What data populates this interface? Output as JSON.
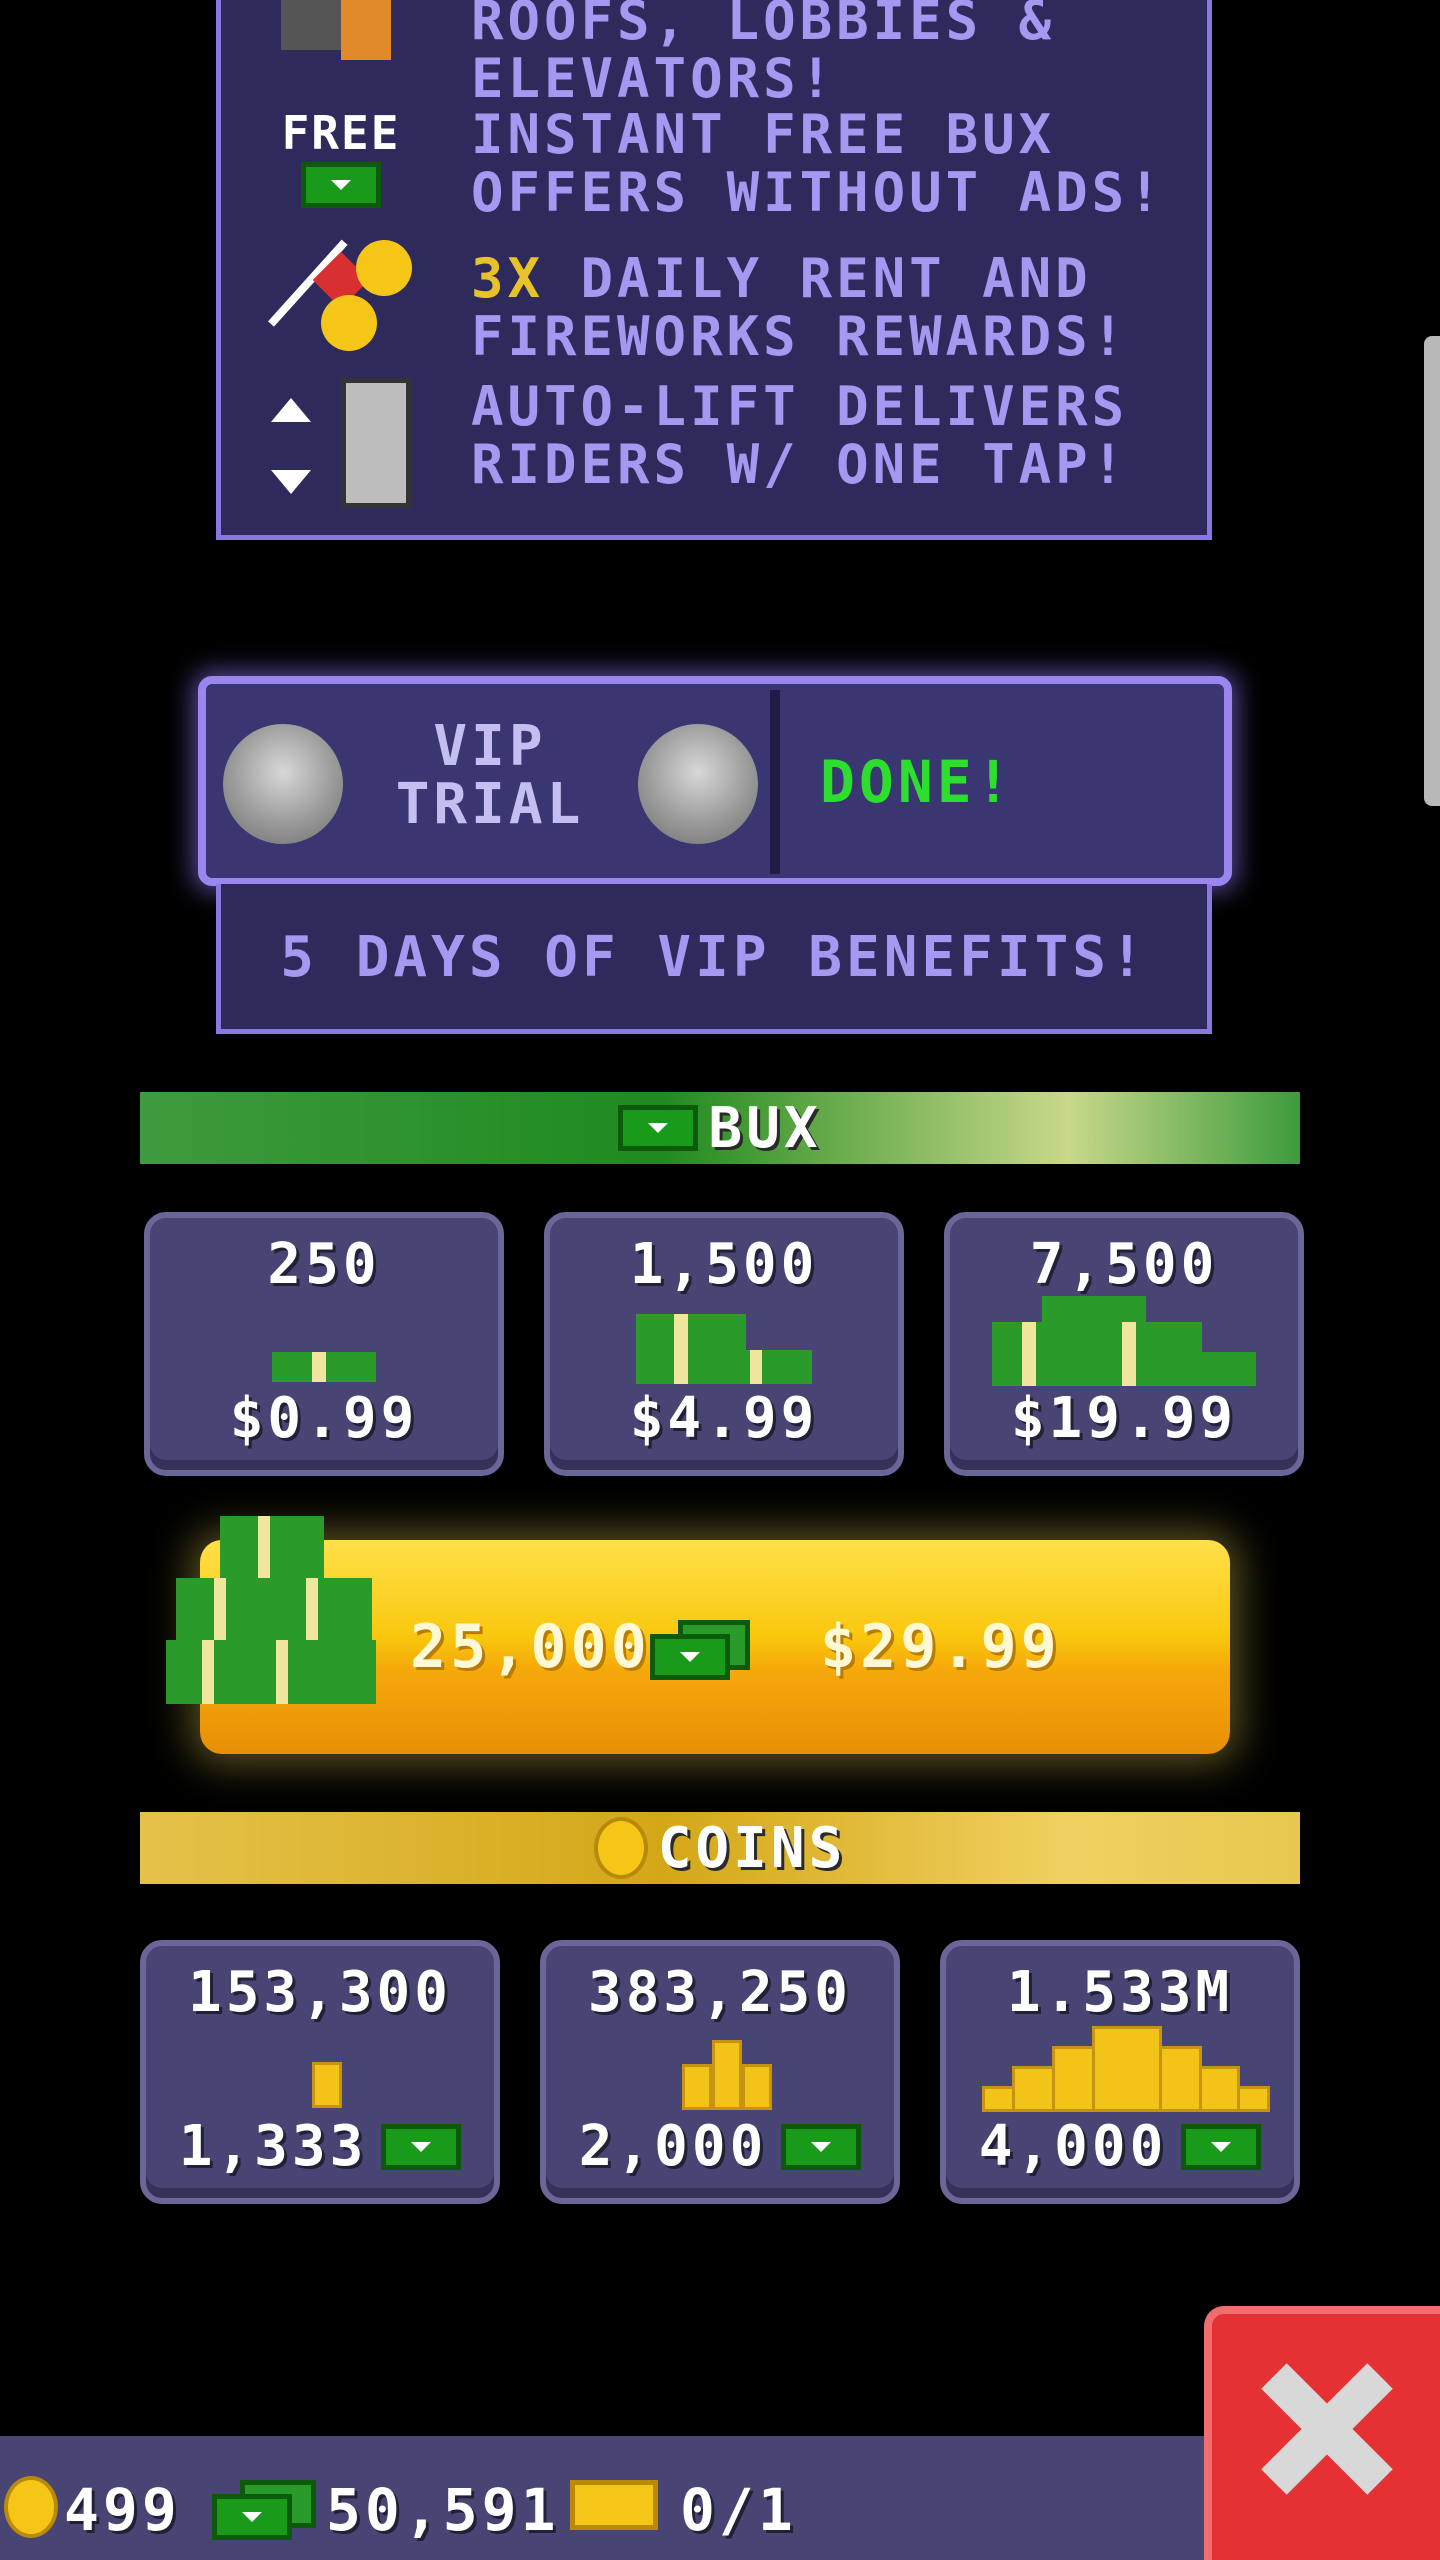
{
  "vip_benefits": {
    "rows": [
      {
        "text": "ROOFS, LOBBIES & ELEVATORS!"
      },
      {
        "icon_label": "FREE",
        "text": "INSTANT FREE BUX OFFERS WITHOUT ADS!"
      },
      {
        "text_highlight": "3X",
        "text": "DAILY RENT AND FIREWORKS REWARDS!"
      },
      {
        "text": "AUTO-LIFT DELIVERS RIDERS W/ ONE TAP!"
      }
    ]
  },
  "vip_trial": {
    "label": "VIP\nTRIAL",
    "status": "DONE!",
    "subtitle": "5 DAYS OF VIP BENEFITS!"
  },
  "bux_section": {
    "title": "BUX",
    "packs": [
      {
        "amount": "250",
        "price": "$0.99"
      },
      {
        "amount": "1,500",
        "price": "$4.99"
      },
      {
        "amount": "7,500",
        "price": "$19.99"
      }
    ],
    "featured": {
      "amount": "25,000",
      "price": "$29.99"
    }
  },
  "coins_section": {
    "title": "COINS",
    "packs": [
      {
        "amount": "153,300",
        "cost": "1,333"
      },
      {
        "amount": "383,250",
        "cost": "2,000"
      },
      {
        "amount": "1.533M",
        "cost": "4,000"
      }
    ]
  },
  "status_bar": {
    "coins": "499",
    "bux": "50,591",
    "tickets": "0/1"
  },
  "colors": {
    "panel_bg": "#2e2a5c",
    "panel_border": "#8a78e0",
    "done_green": "#2ede2e",
    "bux_green": "#1f8a1f",
    "coin_gold": "#f5c518",
    "close_red": "#e53034"
  }
}
